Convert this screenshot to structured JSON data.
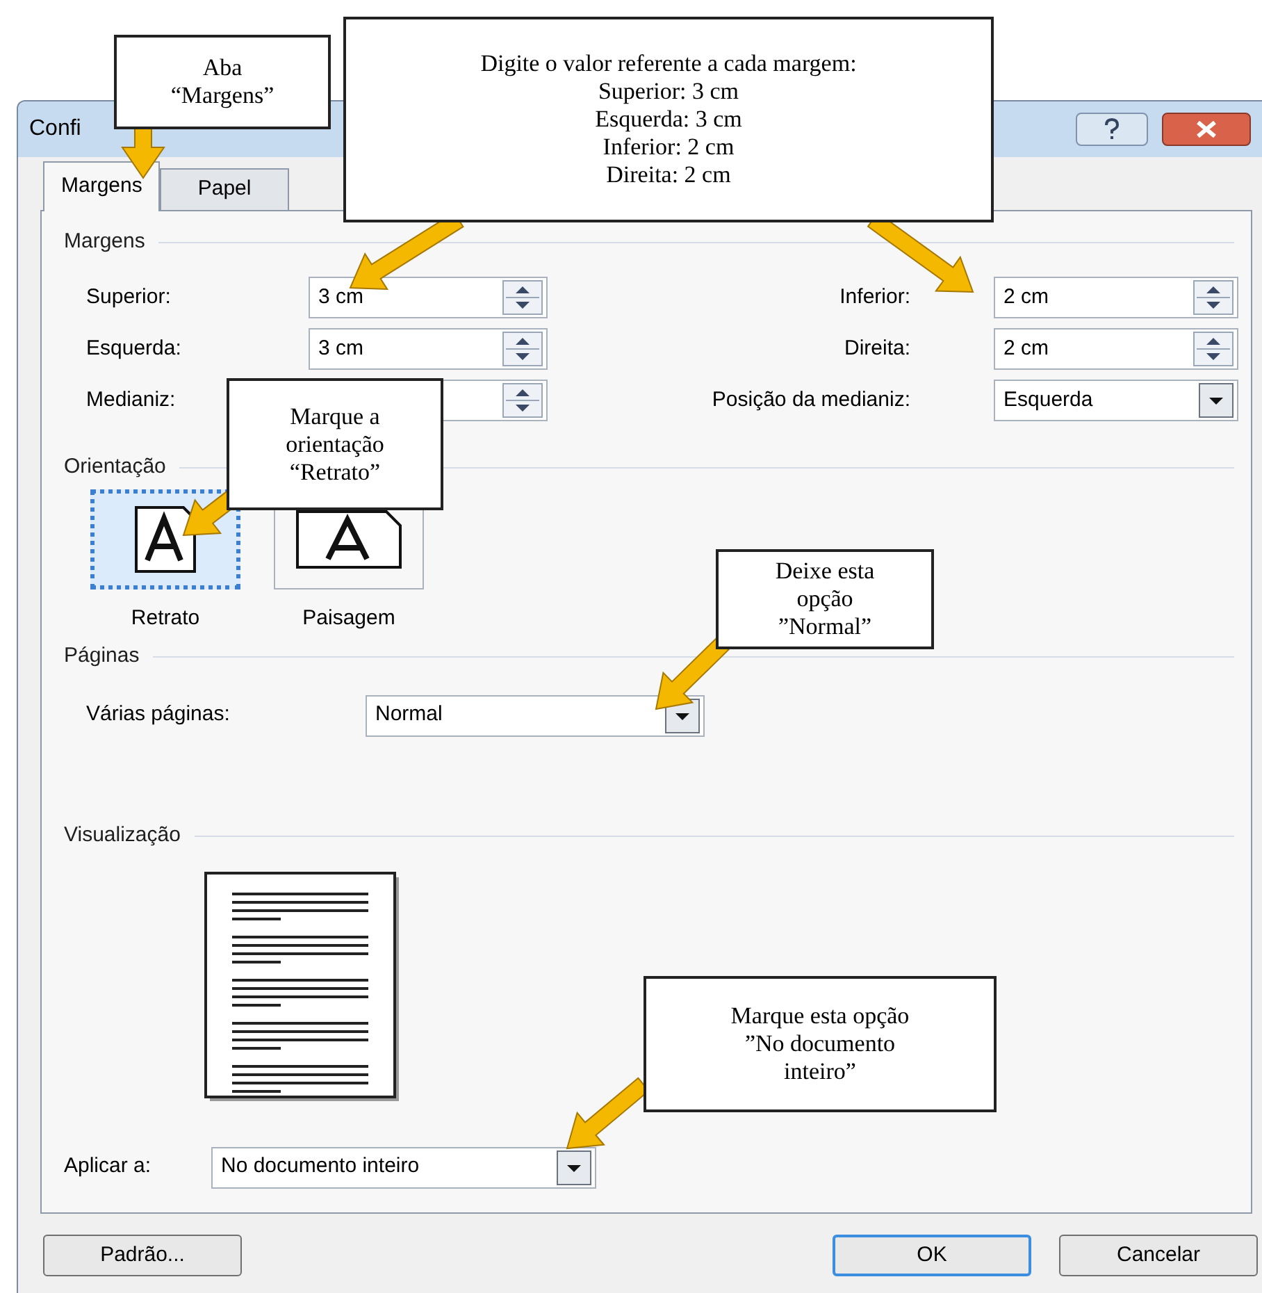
{
  "window": {
    "title": "Confi"
  },
  "tabs": [
    {
      "label": "Margens",
      "selected": true
    },
    {
      "label": "Papel",
      "selected": false
    }
  ],
  "margins": {
    "heading": "Margens",
    "left": [
      {
        "kind": "spin",
        "label": "Superior:",
        "value": "3 cm"
      },
      {
        "kind": "spin",
        "label": "Esquerda:",
        "value": "3 cm"
      },
      {
        "kind": "spin",
        "label": "Medianiz:"
      }
    ],
    "right": [
      {
        "kind": "spin",
        "label": "Inferior:",
        "value": "2 cm"
      },
      {
        "kind": "spin",
        "label": "Direita:",
        "value": "2 cm"
      },
      {
        "kind": "dropdown",
        "label": "Posição da medianiz:",
        "value": "Esquerda"
      }
    ]
  },
  "orientation": {
    "heading": "Orientação",
    "options": [
      {
        "kind": "portrait",
        "label": "Retrato",
        "selected": true
      },
      {
        "kind": "landscape",
        "label": "Paisagem",
        "selected": false
      }
    ]
  },
  "pages": {
    "heading": "Páginas",
    "label": "Várias páginas:",
    "value": "Normal"
  },
  "preview": {
    "heading": "Visualização"
  },
  "apply": {
    "label": "Aplicar a:",
    "value": "No documento inteiro"
  },
  "buttons": [
    {
      "label": "Padrão...",
      "default": false
    },
    {
      "label": "OK",
      "default": true
    },
    {
      "label": "Cancelar",
      "default": false
    }
  ],
  "callouts": [
    {
      "text": "Aba\n“Margens”"
    },
    {
      "text": "Digite o valor referente a cada margem:\nSuperior: 3 cm\nEsquerda: 3 cm\nInferior: 2 cm\nDireita: 2 cm"
    },
    {
      "text": "Marque a\norientação\n“Retrato”"
    },
    {
      "text": "Deixe esta\nopção\n”Normal”"
    },
    {
      "text": "Marque esta opção\n”No documento\ninteiro”"
    }
  ]
}
